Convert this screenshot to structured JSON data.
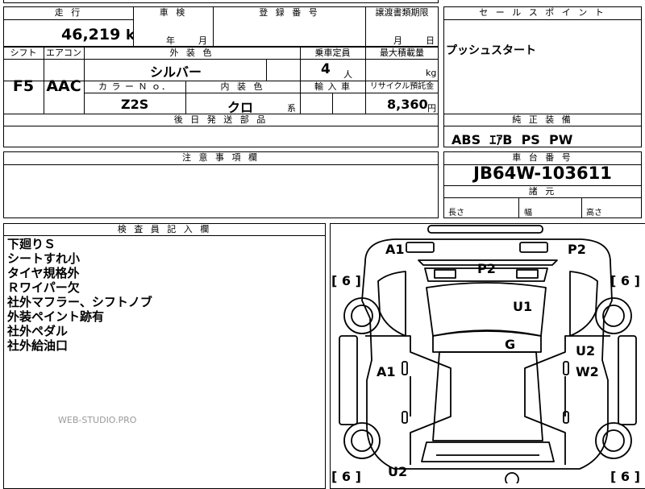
{
  "header": {
    "mileage_label": "走 行",
    "inspection_label": "車 検",
    "registration_label": "登 録 番 号",
    "transfer_docs_label": "譲渡書類期限",
    "sales_point_label": "セ ー ル ス ポ イ ン ト"
  },
  "vehicle": {
    "mileage": "46,219",
    "mileage_unit": "km",
    "inspection_year_unit": "年",
    "inspection_month_unit": "月",
    "transfer_month_unit": "月",
    "transfer_day_unit": "日",
    "sales_point": "プッシュスタート"
  },
  "row2": {
    "shift_label": "シフト",
    "aircon_label": "エアコン",
    "exterior_color_label": "外 装 色",
    "capacity_label": "乗車定員",
    "max_load_label": "最大積載量",
    "shift": "F5",
    "aircon": "AAC",
    "exterior_color": "シルバー",
    "capacity": "4",
    "capacity_unit": "人",
    "max_load_unit": "kg",
    "color_no_label": "カ ラ ー Ｎ ｏ．",
    "interior_color_label": "内 装 色",
    "import_label": "輸 入 車",
    "recycle_label": "リサイクル預託金",
    "color_no": "Z2S",
    "interior_color": "クロ",
    "interior_suffix": "系",
    "recycle_fee": "8,360",
    "recycle_unit": "円"
  },
  "sections": {
    "later_parts_label": "後 日 発 送 部 品",
    "standard_equipment_label": "純 正 装 備",
    "standard_equipment": "ABS  ｴｱB  PS  PW",
    "notes_label": "注 意 事 項 欄",
    "chassis_label": "車 台 番 号",
    "chassis_number": "JB64W-103611",
    "specs_label": "諸 元",
    "length_label": "長さ",
    "width_label": "幅",
    "height_label": "高さ",
    "inspector_label": "検 査 員 記 入 欄"
  },
  "inspector_notes": [
    "下廻りＳ",
    "シートすれ小",
    "タイヤ規格外",
    "Ｒワイパー欠",
    "社外マフラー、シフトノブ",
    "外装ペイント跡有",
    "社外ペダル",
    "社外給油口"
  ],
  "watermark": "WEB-STUDIO.PRO",
  "diagram": {
    "tire_fl": "[ 6 ]",
    "tire_fr": "[ 6 ]",
    "tire_rl": "[ 6 ]",
    "tire_rr": "[ 6 ]",
    "mark_a1_top": "A1",
    "mark_p2_top": "P2",
    "mark_p2_hood": "P2",
    "mark_u1": "U1",
    "mark_g": "G",
    "mark_u2_right": "U2",
    "mark_w2": "W2",
    "mark_a1_left": "A1",
    "mark_u2_bottom": "U2"
  }
}
